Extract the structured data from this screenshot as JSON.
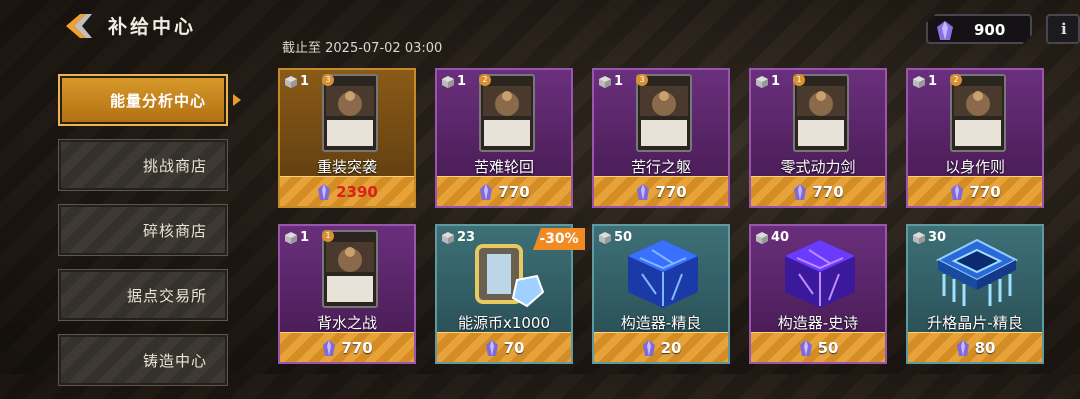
{
  "header": {
    "title": "补给中心",
    "deadline": "截止至 2025-07-02 03:00",
    "currency_amount": "900",
    "info_label": "i"
  },
  "sidebar": {
    "items": [
      {
        "label": "能量分析中心",
        "active": true
      },
      {
        "label": "挑战商店",
        "active": false
      },
      {
        "label": "碎核商店",
        "active": false
      },
      {
        "label": "据点交易所",
        "active": false
      },
      {
        "label": "铸造中心",
        "active": false
      }
    ]
  },
  "items": [
    {
      "name": "重装突袭",
      "count": "1",
      "price": "2390",
      "rarity": "gold",
      "type": "card",
      "price_color": "red",
      "card_badge": "3"
    },
    {
      "name": "苦难轮回",
      "count": "1",
      "price": "770",
      "rarity": "purple",
      "type": "card",
      "card_badge": "2"
    },
    {
      "name": "苦行之躯",
      "count": "1",
      "price": "770",
      "rarity": "purple",
      "type": "card",
      "card_badge": "3"
    },
    {
      "name": "零式动力剑",
      "count": "1",
      "price": "770",
      "rarity": "purple",
      "type": "card",
      "card_badge": "1"
    },
    {
      "name": "以身作则",
      "count": "1",
      "price": "770",
      "rarity": "purple",
      "type": "card",
      "card_badge": "2"
    },
    {
      "name": "背水之战",
      "count": "1",
      "price": "770",
      "rarity": "purple",
      "type": "card",
      "card_badge": "1"
    },
    {
      "name": "能源币x1000",
      "count": "23",
      "price": "70",
      "rarity": "teal",
      "type": "coin",
      "discount": "-30%"
    },
    {
      "name": "构造器-精良",
      "count": "50",
      "price": "20",
      "rarity": "teal",
      "type": "cube-blue"
    },
    {
      "name": "构造器-史诗",
      "count": "40",
      "price": "50",
      "rarity": "purple",
      "type": "cube-purple"
    },
    {
      "name": "升格晶片-精良",
      "count": "30",
      "price": "80",
      "rarity": "teal",
      "type": "chip"
    }
  ]
}
